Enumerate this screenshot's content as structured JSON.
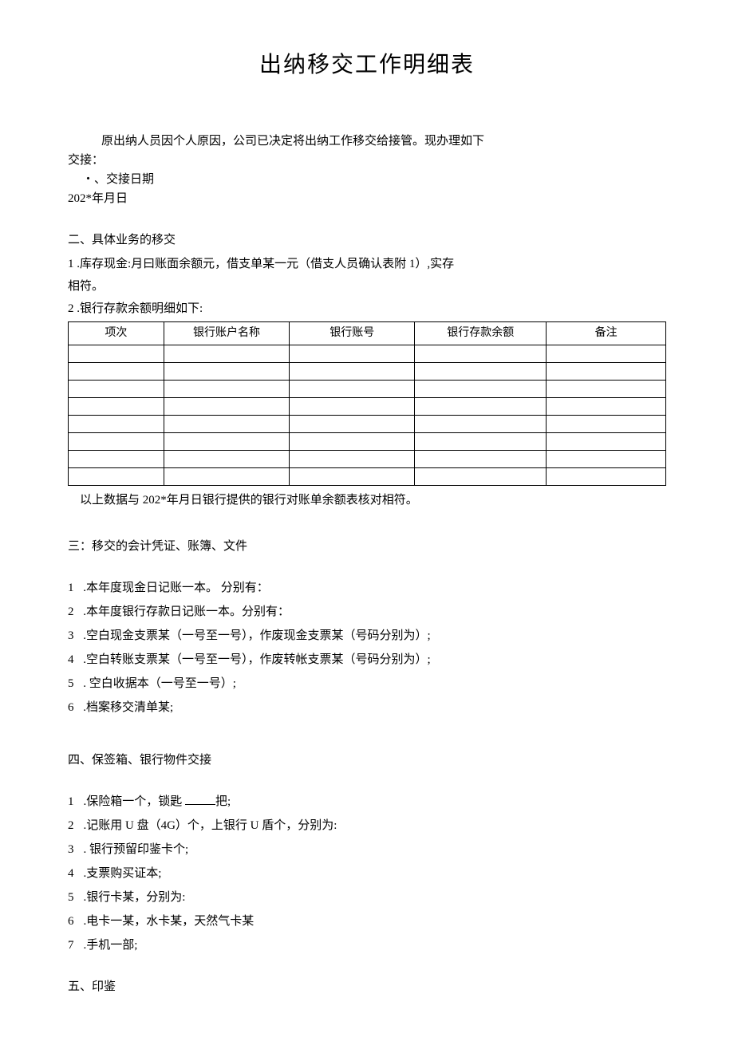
{
  "title": "出纳移交工作明细表",
  "intro": {
    "line1": "原出纳人员因个人原因，公司已决定将出纳工作移交给接管。现办理如下",
    "line2": "交接：",
    "bullet": "・、交接日期",
    "date": "202*年月日"
  },
  "section2": {
    "heading": "二、具体业务的移交",
    "item1_line1": "1 .库存现金:月曰账面余额元，借支单某一元（借支人员确认表附 1）,实存",
    "item1_line2": "相符。",
    "item2": "2   .银行存款余额明细如下:",
    "table": {
      "headers": [
        "项次",
        "银行账户名称",
        "银行账号",
        "银行存款余额",
        "备注"
      ],
      "rows": 8
    },
    "after_table": "以上数据与 202*年月日银行提供的银行对账单余额表核对相符。"
  },
  "section3": {
    "heading": "三：移交的会计凭证、账簿、文件",
    "items": [
      {
        "num": "1",
        "text": ".本年度现金日记账一本。      分别有："
      },
      {
        "num": "2",
        "text": ".本年度银行存款日记账一本。分别有："
      },
      {
        "num": "3",
        "text": ".空白现金支票某（一号至一号），作废现金支票某（号码分别为）;"
      },
      {
        "num": "4",
        "text": ".空白转账支票某（一号至一号），作废转帐支票某（号码分别为）;"
      },
      {
        "num": "5",
        "text": ". 空白收据本（一号至一号）;"
      },
      {
        "num": "6",
        "text": ".档案移交清单某;"
      }
    ]
  },
  "section4": {
    "heading": "四、保签箱、银行物件交接",
    "items": [
      {
        "num": "1",
        "text_before": ".保险箱一个，锁匙 ",
        "text_after": "把;",
        "has_blank": true
      },
      {
        "num": "2",
        "text": ".记账用 U 盘（4G）个，上银行 U 盾个，分别为:"
      },
      {
        "num": "3",
        "text": ". 银行预留印鉴卡个;"
      },
      {
        "num": "4",
        "text": ".支票购买证本;"
      },
      {
        "num": "5",
        "text": ".银行卡某，分别为:"
      },
      {
        "num": "6",
        "text": ".电卡一某，水卡某，天然气卡某"
      },
      {
        "num": "7",
        "text": ".手机一部;"
      }
    ]
  },
  "section5": {
    "heading": "五、印鉴"
  }
}
